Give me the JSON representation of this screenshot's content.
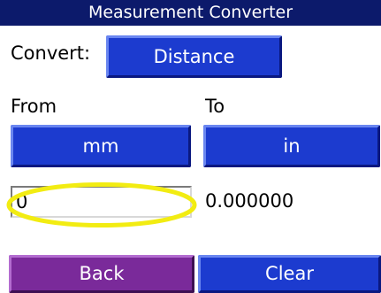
{
  "window": {
    "title": "Measurement Converter"
  },
  "convert": {
    "label": "Convert:",
    "category_button": "Distance"
  },
  "from": {
    "label": "From",
    "unit_button": "mm",
    "input_value": "0"
  },
  "to": {
    "label": "To",
    "unit_button": "in",
    "result_value": "0.000000"
  },
  "footer": {
    "back_label": "Back",
    "clear_label": "Clear"
  },
  "colors": {
    "title_bar": "#0c1a6b",
    "button_blue": "#1c3bcf",
    "button_purple": "#7a2a9a",
    "highlight_yellow": "#f2ec12"
  }
}
